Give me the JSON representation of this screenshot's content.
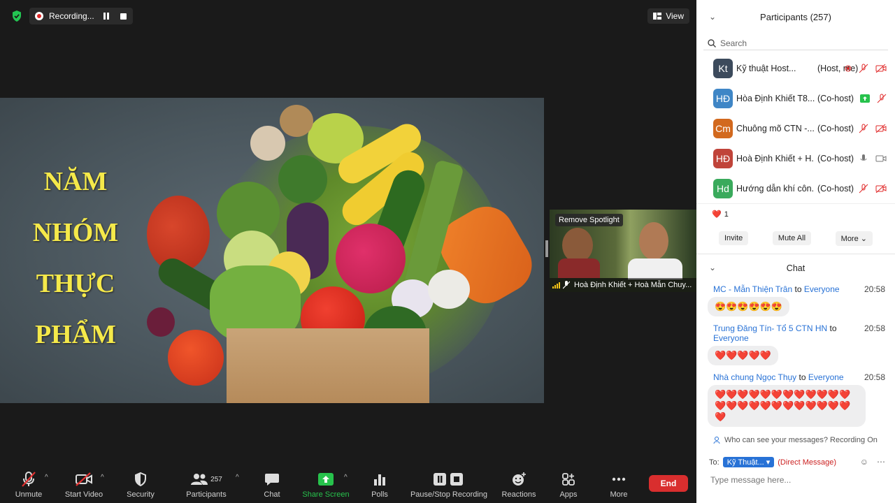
{
  "recording": {
    "label": "Recording..."
  },
  "view_button": {
    "label": "View"
  },
  "slide": {
    "title_lines": [
      "NĂM",
      "NHÓM",
      "THỰC",
      "PHẨM"
    ]
  },
  "thumbnail": {
    "spotlight_label": "Remove Spotlight",
    "name": "Hoà Định Khiết + Hoà Mẫn Chuy..."
  },
  "toolbar": {
    "unmute": "Unmute",
    "start_video": "Start Video",
    "security": "Security",
    "participants": "Participants",
    "participants_count": "257",
    "chat": "Chat",
    "share_screen": "Share Screen",
    "polls": "Polls",
    "pause_stop": "Pause/Stop Recording",
    "reactions": "Reactions",
    "apps": "Apps",
    "more": "More",
    "end": "End"
  },
  "participants_panel": {
    "title": "Participants (257)",
    "search_placeholder": "Search",
    "rows": [
      {
        "initials": "Kt",
        "color": "#3c4a5c",
        "name": "Kỹ thuật Host...",
        "role": "(Host, me)"
      },
      {
        "initials": "HĐ",
        "color": "#3f86c6",
        "name": "Hòa Định Khiết T8...",
        "role": "(Co-host)"
      },
      {
        "initials": "Cm",
        "color": "#d2691e",
        "name": "Chuông mõ CTN -...",
        "role": "(Co-host)"
      },
      {
        "initials": "HĐ",
        "color": "#c0443a",
        "name": "Hoà Định Khiết + H...",
        "role": "(Co-host)"
      },
      {
        "initials": "Hd",
        "color": "#3aaa5c",
        "name": "Hướng dẫn khí côn...",
        "role": "(Co-host)"
      }
    ],
    "reaction_count": "1",
    "invite": "Invite",
    "mute_all": "Mute All",
    "more": "More"
  },
  "chat_panel": {
    "title": "Chat",
    "messages": [
      {
        "from": "MC - Mẫn Thiện Trân",
        "to_word": "to",
        "to": "Everyone",
        "time": "20:58",
        "body": "😍😍😍😍😍😍"
      },
      {
        "from": "Trung Đăng Tín- Tổ 5 CTN HN",
        "to_word": "to",
        "to": "Everyone",
        "time": "20:58",
        "body": "❤️❤️❤️❤️❤️"
      },
      {
        "from": "Nhà chung Ngọc Thụy",
        "to_word": "to",
        "to": "Everyone",
        "time": "20:58",
        "body": "❤️❤️❤️❤️❤️❤️❤️❤️❤️❤️❤️❤️❤️❤️❤️❤️❤️❤️❤️❤️❤️❤️❤️❤️❤️"
      }
    ],
    "who_can_see": "Who can see your messages? Recording On",
    "to_label": "To:",
    "to_value": "Kỹ Thuật...",
    "direct_message": "(Direct Message)",
    "input_placeholder": "Type message here..."
  }
}
